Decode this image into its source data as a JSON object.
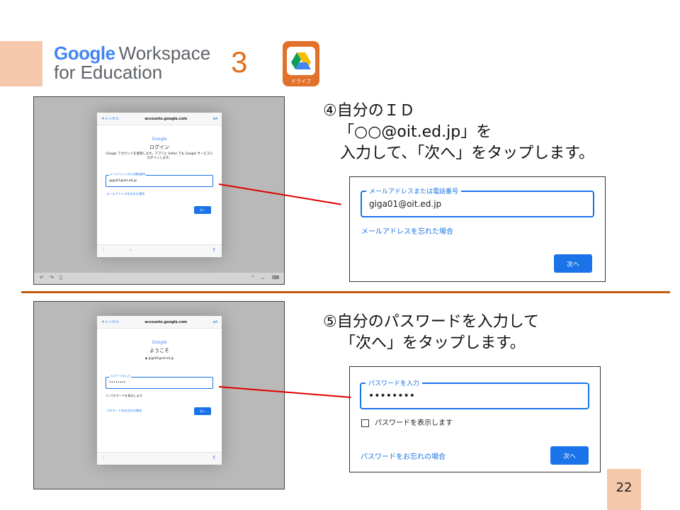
{
  "header": {
    "logo_google": "Google",
    "logo_workspace": "Workspace",
    "logo_education": "for Education",
    "step_number": "3",
    "drive_label": "ドライブ"
  },
  "step4": {
    "lines": [
      "④自分のＩＤ",
      "「○○@oit.ed.jp」を",
      "入力して、「次へ」をタップします。"
    ],
    "screenshot": {
      "cancel": "キャンセル",
      "url": "accounts.google.com",
      "aa": "aA",
      "google": "Google",
      "title": "ログイン",
      "desc": "Google アカウントを使用します。アプリと Safari でも Google サービスにログインします。",
      "field_label": "メールアドレスまたは電話番号",
      "field_value": "giga01@oit.ed.jp",
      "forgot": "メールアドレスを忘れた場合",
      "next": "次へ"
    },
    "zoom": {
      "field_label": "メールアドレスまたは電話番号",
      "field_value": "giga01@oit.ed.jp",
      "forgot": "メールアドレスを忘れた場合",
      "next": "次へ"
    }
  },
  "step5": {
    "lines": [
      "⑤自分のパスワードを入力して",
      "「次へ」をタップします。"
    ],
    "screenshot": {
      "cancel": "キャンセル",
      "url": "accounts.google.com",
      "aa": "aA",
      "google": "Google",
      "title": "ようこそ",
      "account": "giga01@oit.ed.jp",
      "field_label": "パスワードを入力",
      "field_value": "••••••••",
      "show_password": "パスワードを表示します",
      "forgot": "パスワードをお忘れの場合",
      "next": "次へ"
    },
    "zoom": {
      "field_label": "パスワードを入力",
      "field_value": "••••••••",
      "show_password": "パスワードを表示します",
      "forgot": "パスワードをお忘れの場合",
      "next": "次へ"
    }
  },
  "page_number": "22",
  "colors": {
    "accent": "#e0701c",
    "peach": "#f6c8ab",
    "google_blue": "#1a73e8",
    "callout_red": "#e00000",
    "divider": "#c55a11"
  }
}
